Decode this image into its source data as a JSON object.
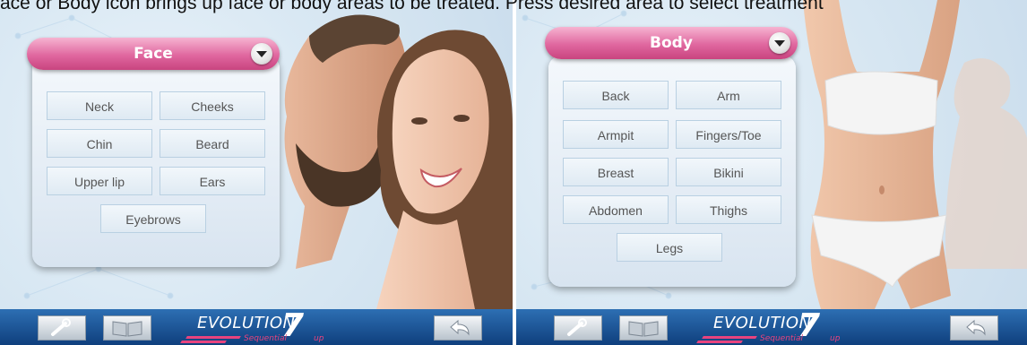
{
  "caption": "ace or Body icon brings up face or body areas to be treated. Press desired area to select treatment",
  "screens": {
    "face": {
      "header": "Face",
      "buttons": [
        "Neck",
        "Cheeks",
        "Chin",
        "Beard",
        "Upper lip",
        "Ears",
        "Eyebrows"
      ]
    },
    "body": {
      "header": "Body",
      "buttons": [
        "Back",
        "Arm",
        "Armpit",
        "Fingers/Toe",
        "Breast",
        "Bikini",
        "Abdomen",
        "Thighs",
        "Legs"
      ]
    }
  },
  "bottom_bar": {
    "logo_text": "EVOLUTION",
    "logo_number": "7",
    "logo_sub": "Sequential",
    "logo_sub2": "up",
    "icons": [
      "wrench-icon",
      "book-icon",
      "back-arrow-icon"
    ]
  },
  "colors": {
    "header_pink": "#e0679f",
    "bar_blue": "#0f3f7d",
    "logo_pink": "#e8437e"
  }
}
